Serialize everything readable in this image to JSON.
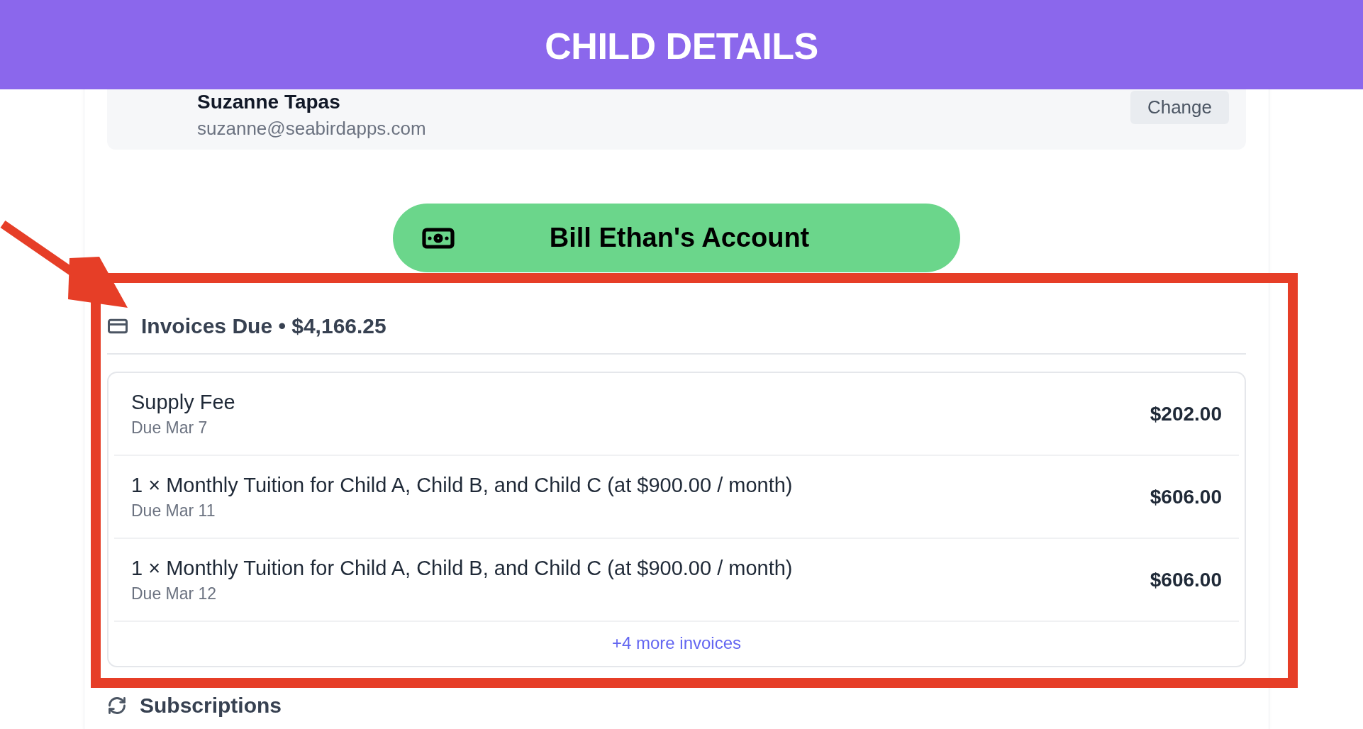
{
  "header": {
    "title": "CHILD DETAILS"
  },
  "payer": {
    "name": "Suzanne Tapas",
    "email": "suzanne@seabirdapps.com",
    "action": "Change"
  },
  "bill_button": {
    "label": "Bill Ethan's Account"
  },
  "invoices": {
    "title": "Invoices Due • $4,166.25",
    "items": [
      {
        "name": "Supply Fee",
        "due": "Due Mar 7",
        "amount": "$202.00"
      },
      {
        "name": "1 × Monthly Tuition for Child A, Child B, and Child C (at $900.00 / month)",
        "due": "Due Mar 11",
        "amount": "$606.00"
      },
      {
        "name": "1 × Monthly Tuition for Child A, Child B, and Child C (at $900.00 / month)",
        "due": "Due Mar 12",
        "amount": "$606.00"
      }
    ],
    "more": "+4 more invoices"
  },
  "subscriptions": {
    "title": "Subscriptions"
  }
}
